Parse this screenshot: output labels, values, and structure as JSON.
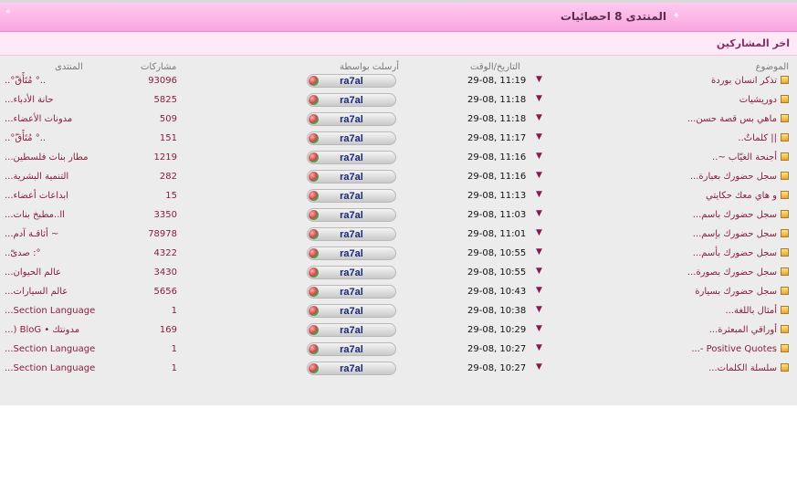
{
  "header": {
    "title": "المنتدى 8 احصائيات",
    "collapse_label": "«"
  },
  "subheader": {
    "label": "اخر المشاركين"
  },
  "columns": {
    "topic": "الموضوع",
    "datetime": "التاريخ/الوقت",
    "sender": "أرسلت بواسطة",
    "posts": "مشاركات",
    "forum": "المنتدى"
  },
  "rows": [
    {
      "topic": "تذكر انسان بوردة",
      "time": "29-08, 11:19",
      "sender": "ra7al",
      "posts": "93096",
      "forum": "..° مُتَأَقّ°.."
    },
    {
      "topic": "دوريشيات",
      "time": "29-08, 11:18",
      "sender": "ra7al",
      "posts": "5825",
      "forum": "حانة الأدباء..."
    },
    {
      "topic": "ماهي بس قصة حسن...",
      "time": "29-08, 11:18",
      "sender": "ra7al",
      "posts": "509",
      "forum": "مدونات الأعضاء..."
    },
    {
      "topic": "|| كلماتٌ..",
      "time": "29-08, 11:17",
      "sender": "ra7al",
      "posts": "151",
      "forum": "..° مُتَأَقّ°.."
    },
    {
      "topic": "أجنحة الغيّاب ~..",
      "time": "29-08, 11:16",
      "sender": "ra7al",
      "posts": "1219",
      "forum": "مطار بنات فلسطين..."
    },
    {
      "topic": "سجل حضورك بعبارة...",
      "time": "29-08, 11:16",
      "sender": "ra7al",
      "posts": "282",
      "forum": "التنمية البشرية..."
    },
    {
      "topic": "و هاي معك حكايتي",
      "time": "29-08, 11:13",
      "sender": "ra7al",
      "posts": "15",
      "forum": "ابداعات أعضاء..."
    },
    {
      "topic": "سجل حضورك باسم...",
      "time": "29-08, 11:03",
      "sender": "ra7al",
      "posts": "3350",
      "forum": "اا..مطبخ بنات..."
    },
    {
      "topic": "سجل حضورك بإسم...",
      "time": "29-08, 11:01",
      "sender": "ra7al",
      "posts": "78978",
      "forum": "~ أثاقـة آدم..."
    },
    {
      "topic": "سجل حضورك بأسم...",
      "time": "29-08, 10:55",
      "sender": "ra7al",
      "posts": "4322",
      "forum": "°: صدىّ.."
    },
    {
      "topic": "سجل حضورك بصورة...",
      "time": "29-08, 10:55",
      "sender": "ra7al",
      "posts": "3430",
      "forum": "عالم الحيوان..."
    },
    {
      "topic": "سجل حضورك بسيارة",
      "time": "29-08, 10:43",
      "sender": "ra7al",
      "posts": "5656",
      "forum": "عالم السيارات..."
    },
    {
      "topic": "أمثال باللغة...",
      "time": "29-08, 10:38",
      "sender": "ra7al",
      "posts": "1",
      "forum": "Section Language..."
    },
    {
      "topic": "أوراقي المبعثرة...",
      "time": "29-08, 10:29",
      "sender": "ra7al",
      "posts": "169",
      "forum": "مدونتك • BloG (..."
    },
    {
      "topic": "Positive Quotes -...",
      "time": "29-08, 10:27",
      "sender": "ra7al",
      "posts": "1",
      "forum": "Section Language..."
    },
    {
      "topic": "سلسلة الكلمات...",
      "time": "29-08, 10:27",
      "sender": "ra7al",
      "posts": "1",
      "forum": "Section Language..."
    }
  ],
  "colors": {
    "accent_pink": "#f9a6df",
    "link": "#8a1e3c",
    "sender_text": "#1a2a7a"
  }
}
